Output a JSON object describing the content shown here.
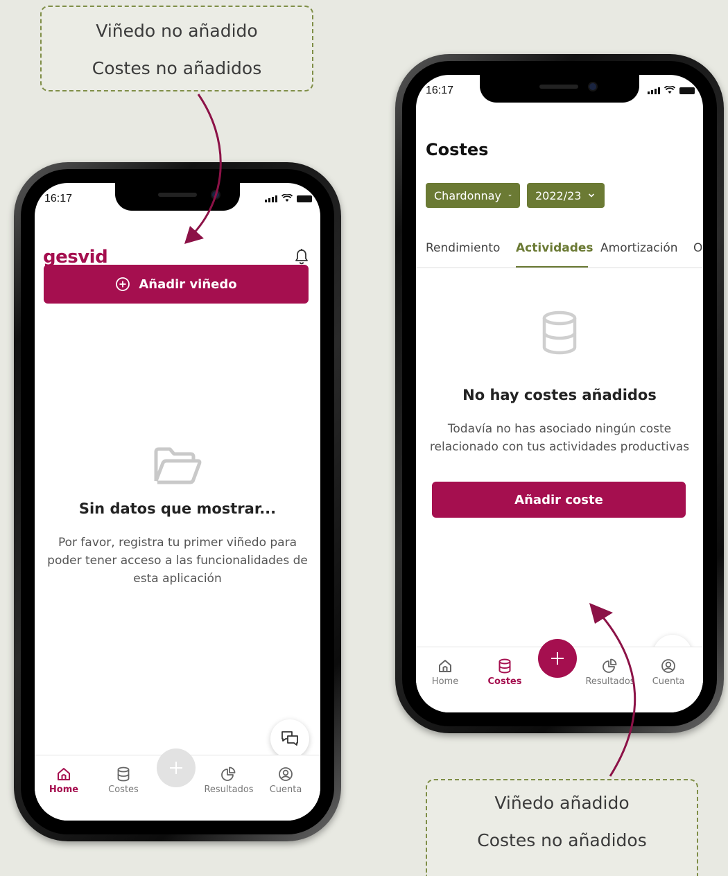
{
  "callouts": [
    {
      "line1": "Viñedo no añadido",
      "line2": "Costes no añadidos"
    },
    {
      "line1": "Viñedo añadido",
      "line2": "Costes no añadidos"
    }
  ],
  "colors": {
    "brand": "#a50f4f",
    "olive": "#6b7a34",
    "callout_border": "#7f8e47",
    "arrow": "#8c1247"
  },
  "phone1": {
    "status_time": "16:17",
    "logo": "gesvid",
    "add_vineyard_label": "Añadir viñedo",
    "empty_title": "Sin datos que mostrar...",
    "empty_desc": "Por favor, registra tu primer viñedo para poder tener acceso a las funcionalidades de esta aplicación",
    "tabs": [
      {
        "label": "Home",
        "icon": "home-icon",
        "active": true
      },
      {
        "label": "Costes",
        "icon": "database-icon",
        "active": false
      },
      {
        "label": "Resultados",
        "icon": "pie-chart-icon",
        "active": false
      },
      {
        "label": "Cuenta",
        "icon": "account-icon",
        "active": false
      }
    ]
  },
  "phone2": {
    "status_time": "16:17",
    "title": "Costes",
    "filter_vineyard": "Chardonnay",
    "filter_season": "2022/23",
    "section_tabs": [
      "Rendimiento",
      "Actividades",
      "Amortización",
      "O"
    ],
    "active_section": "Actividades",
    "empty_title": "No hay costes añadidos",
    "empty_desc": "Todavía no has asociado ningún coste relacionado con tus actividades productivas",
    "add_cost_label": "Añadir coste",
    "tabs": [
      {
        "label": "Home",
        "icon": "home-icon",
        "active": false
      },
      {
        "label": "Costes",
        "icon": "database-icon",
        "active": true
      },
      {
        "label": "Resultados",
        "icon": "pie-chart-icon",
        "active": false
      },
      {
        "label": "Cuenta",
        "icon": "account-icon",
        "active": false
      }
    ]
  }
}
